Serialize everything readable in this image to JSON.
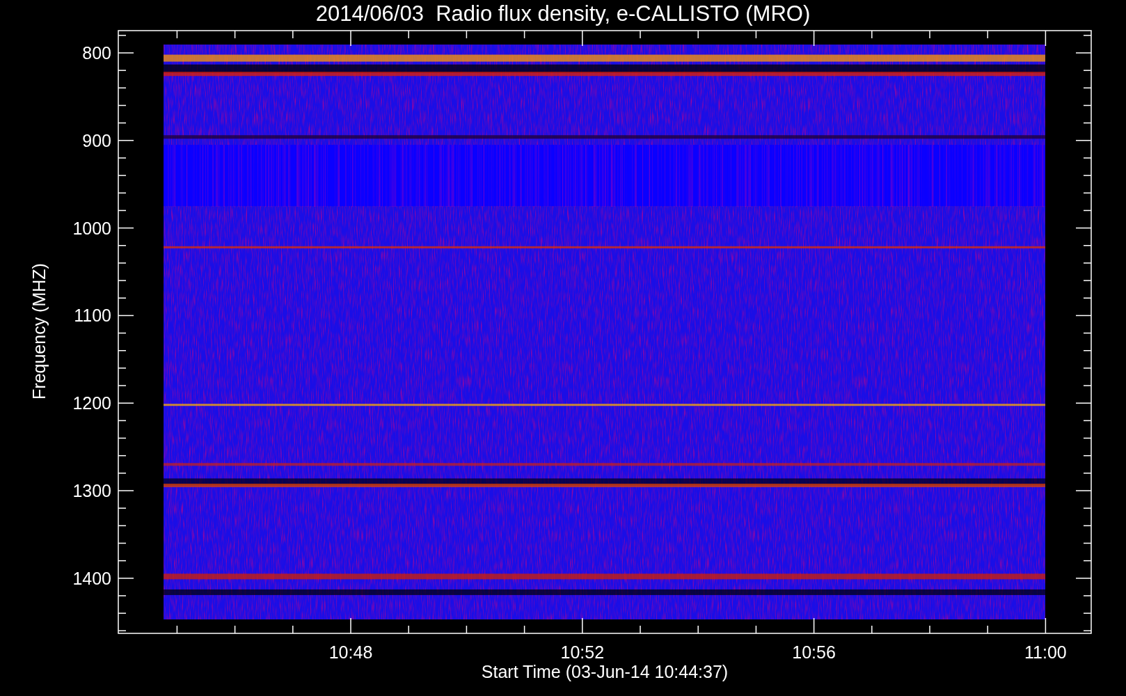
{
  "title": "2014/06/03  Radio flux density, e-CALLISTO (MRO)",
  "y_axis": {
    "label": "Frequency (MHZ)",
    "ticks": [
      "800",
      "900",
      "1000",
      "1100",
      "1200",
      "1300",
      "1400"
    ]
  },
  "x_axis": {
    "label": "Start Time (03-Jun-14 10:44:37)",
    "ticks": [
      "10:48",
      "10:52",
      "10:56",
      "11:00"
    ]
  }
}
